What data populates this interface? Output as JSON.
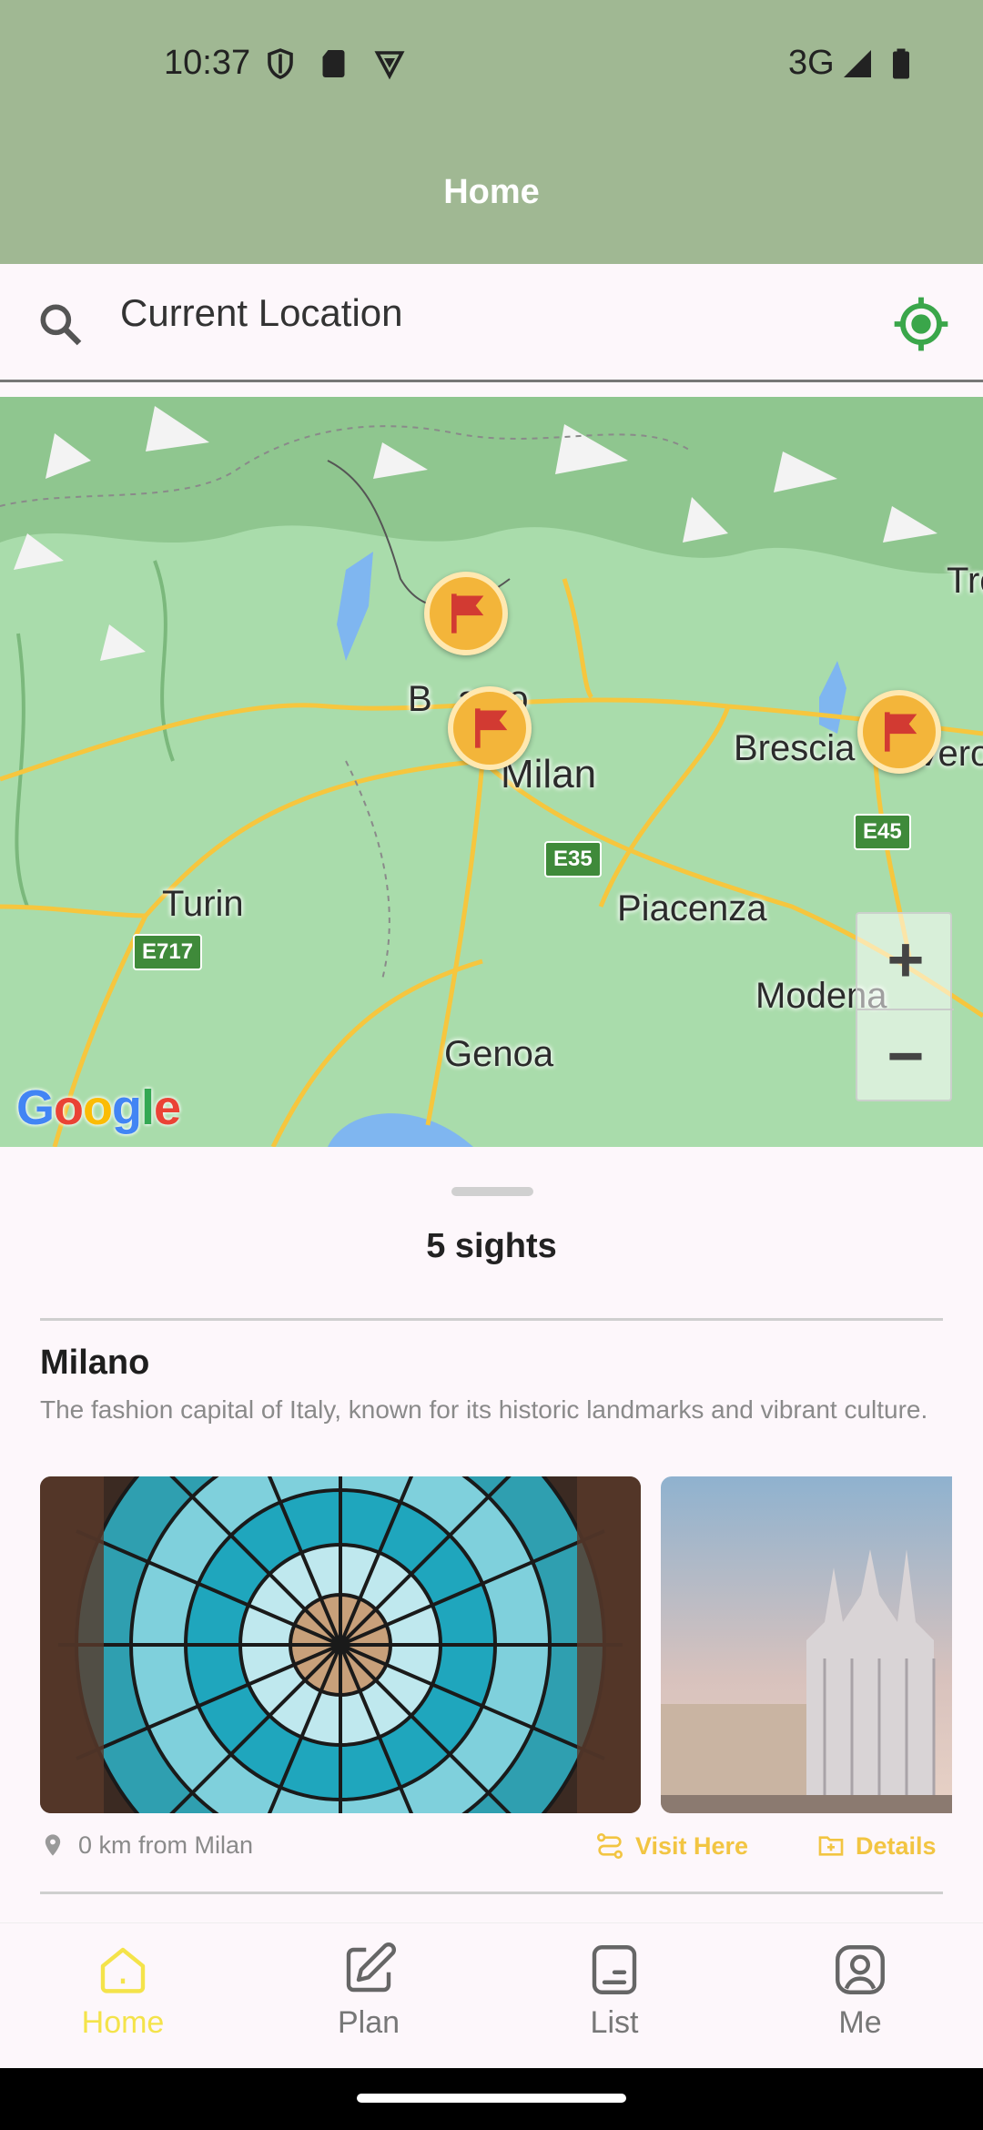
{
  "status_bar": {
    "time": "10:37",
    "network": "3G",
    "icons": [
      "shield-icon",
      "sd-card-icon",
      "vpn-icon",
      "signal-icon",
      "battery-icon"
    ]
  },
  "app_bar": {
    "title": "Home"
  },
  "search": {
    "current_location": "Current Location",
    "icons": [
      "search-icon",
      "my-location-icon"
    ]
  },
  "map": {
    "cities": [
      "Milan",
      "Turin",
      "Genoa",
      "Brescia",
      "Piacenza",
      "Modena",
      "Bergamo",
      "Verona",
      "Trento"
    ],
    "city_labels": {
      "milan": "Milan",
      "turin": "Turin",
      "genoa": "Genoa",
      "brescia": "Brescia",
      "piacenza": "Piacenza",
      "modena": "Modena",
      "bergamo": "B",
      "bergamo_tail": "amo",
      "verona": "Vero",
      "trento": "Tre"
    },
    "road_badges": [
      "E35",
      "E45",
      "E717"
    ],
    "zoom_in": "+",
    "zoom_out": "−",
    "logo": "Google",
    "pin_count": 3
  },
  "sheet": {
    "count_label": "5 sights",
    "sight": {
      "title": "Milano",
      "description": "The fashion capital of Italy, known for its historic landmarks and vibrant culture.",
      "distance": "0 km from Milan",
      "visit_label": "Visit Here",
      "details_label": "Details",
      "photos": [
        "galleria-dome-photo",
        "duomo-photo"
      ]
    }
  },
  "nav": {
    "tabs": [
      {
        "label": "Home",
        "icon": "home-icon",
        "active": true
      },
      {
        "label": "Plan",
        "icon": "edit-icon",
        "active": false
      },
      {
        "label": "List",
        "icon": "list-icon",
        "active": false
      },
      {
        "label": "Me",
        "icon": "profile-icon",
        "active": false
      }
    ]
  },
  "colors": {
    "app_bar": "#a0b893",
    "accent": "#f2c542",
    "active_tab": "#f4e34a",
    "location_icon": "#3aa64a"
  }
}
